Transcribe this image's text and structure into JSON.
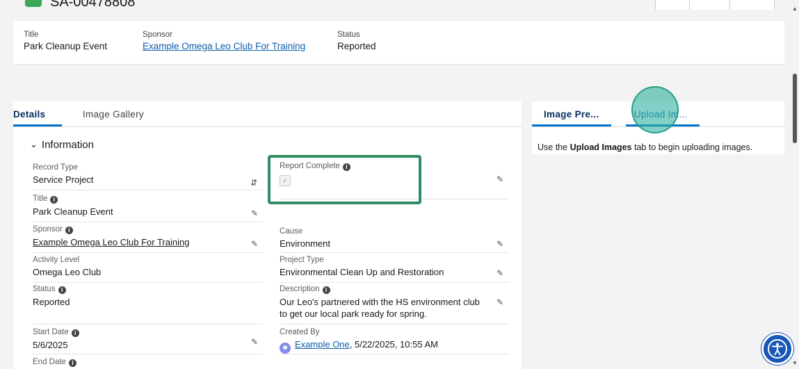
{
  "record": {
    "number": "SA-00478808"
  },
  "highlights": {
    "title_label": "Title",
    "title_value": "Park Cleanup Event",
    "sponsor_label": "Sponsor",
    "sponsor_value": "Example Omega Leo Club For Training",
    "status_label": "Status",
    "status_value": "Reported"
  },
  "left_tabs": [
    "Details",
    "Image Gallery"
  ],
  "section": {
    "title": "Information"
  },
  "fields": {
    "record_type": {
      "label": "Record Type",
      "value": "Service Project"
    },
    "title": {
      "label": "Title",
      "value": "Park Cleanup Event"
    },
    "sponsor": {
      "label": "Sponsor",
      "value": "Example Omega Leo Club For Training"
    },
    "activity_level": {
      "label": "Activity Level",
      "value": "Omega Leo Club"
    },
    "status": {
      "label": "Status",
      "value": "Reported"
    },
    "start_date": {
      "label": "Start Date",
      "value": "5/6/2025"
    },
    "end_date": {
      "label": "End Date"
    },
    "report_complete": {
      "label": "Report Complete",
      "checked": true
    },
    "cause": {
      "label": "Cause",
      "value": "Environment"
    },
    "project_type": {
      "label": "Project Type",
      "value": "Environmental Clean Up and Restoration"
    },
    "description": {
      "label": "Description",
      "value": "Our Leo's partnered with the HS environment club to get our local park ready for spring."
    },
    "created_by": {
      "label": "Created By",
      "user": "Example One",
      "timestamp": ", 5/22/2025, 10:55 AM"
    }
  },
  "right_tabs": [
    "Image Pre...",
    "Upload Im..."
  ],
  "right_text": {
    "prefix": "Use the ",
    "bold": "Upload Images",
    "suffix": " tab to begin uploading images."
  },
  "colors": {
    "highlight": "#2e8b62",
    "accent": "#0176d3",
    "click_marker": "#2eb0a0"
  },
  "icons": [
    "record-type-swap-icon",
    "pencil-icon",
    "info-icon",
    "user-avatar-icon",
    "accessibility-icon",
    "chevron-down-icon"
  ]
}
